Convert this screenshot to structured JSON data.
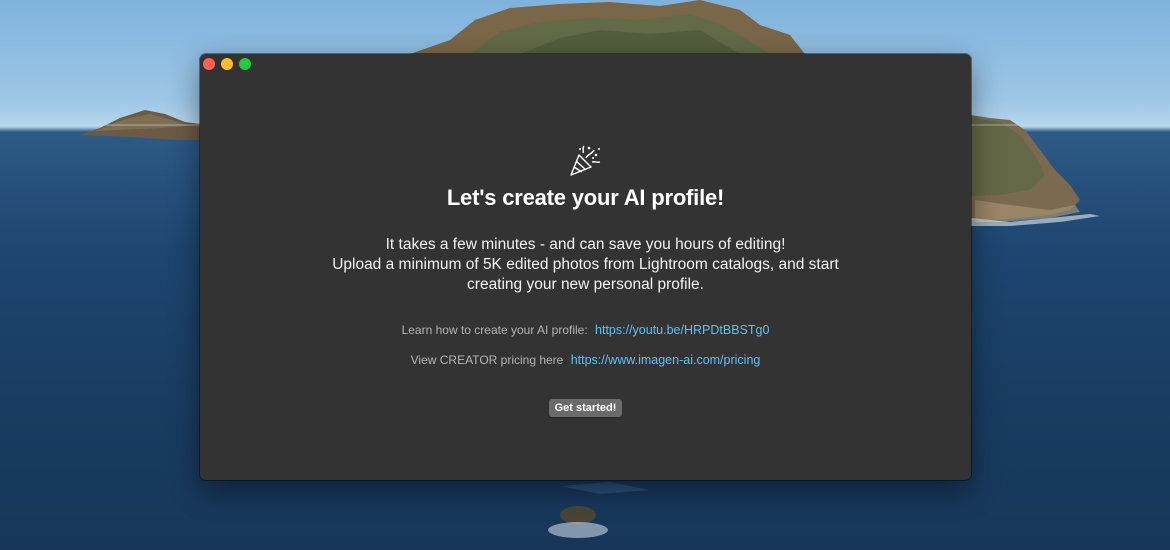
{
  "window": {
    "title_text": "Let's create your AI profile!",
    "description_lines": [
      "It takes a few minutes - and can save you hours of editing!",
      "Upload a minimum of 5K edited photos from Lightroom catalogs, and start",
      "creating your new personal profile."
    ],
    "learn_label": "Learn how to create your AI profile:",
    "learn_link": "https://youtu.be/HRPDtBBSTg0",
    "pricing_label": "View CREATOR pricing here",
    "pricing_link": "https://www.imagen-ai.com/pricing",
    "button_label": "Get started!",
    "icon": "party-popper-icon"
  },
  "colors": {
    "window_bg": "#333333",
    "link": "#5ec3f0",
    "button_bg": "#6a6a6a",
    "close": "#ff5f57",
    "minimize": "#febc2e",
    "maximize": "#28c840"
  }
}
